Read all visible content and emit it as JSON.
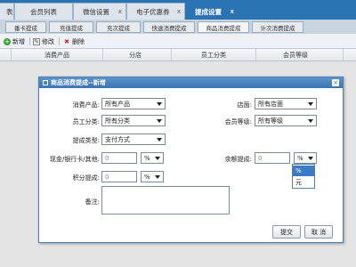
{
  "top_tabs": [
    {
      "label": "表",
      "active": false
    },
    {
      "label": "会员列表",
      "active": false
    },
    {
      "label": "微信设置",
      "close": "x",
      "active": false
    },
    {
      "label": "电子优惠券",
      "close": "x",
      "active": false
    },
    {
      "label": "提成设置",
      "close": "x",
      "active": true
    }
  ],
  "sub_tabs": [
    "番卡提成",
    "充值提成",
    "充次提成",
    "快速消费提成",
    "商品消费提成",
    "计次消费提成"
  ],
  "toolbar": {
    "add": "新增",
    "edit": "修改",
    "delete": "删除"
  },
  "grid_headers": [
    "消费产品",
    "分店",
    "员工分类",
    "会员等级"
  ],
  "dialog": {
    "title": "商品消费提成--新增",
    "close": "×",
    "fields": {
      "product_label": "消费产品:",
      "product_value": "所有产品",
      "store_label": "店面:",
      "store_value": "所有店面",
      "staff_label": "员工分类:",
      "staff_value": "所有分类",
      "level_label": "会员等级:",
      "level_value": "所有等级",
      "type_label": "提成类型:",
      "type_value": "支付方式",
      "cash_label": "现金/银行卡/其他:",
      "cash_value": "0",
      "cash_unit": "%",
      "balance_label": "余额提成:",
      "balance_value": "0",
      "balance_unit": "%",
      "points_label": "积分提成:",
      "points_value": "0",
      "points_unit": "%",
      "note_label": "备注:"
    },
    "dropdown_options": [
      "%",
      "元"
    ],
    "submit": "提交",
    "cancel": "取 消"
  },
  "colors": {
    "accent": "#2a73b2",
    "dialog_title": "#3a74b2"
  }
}
